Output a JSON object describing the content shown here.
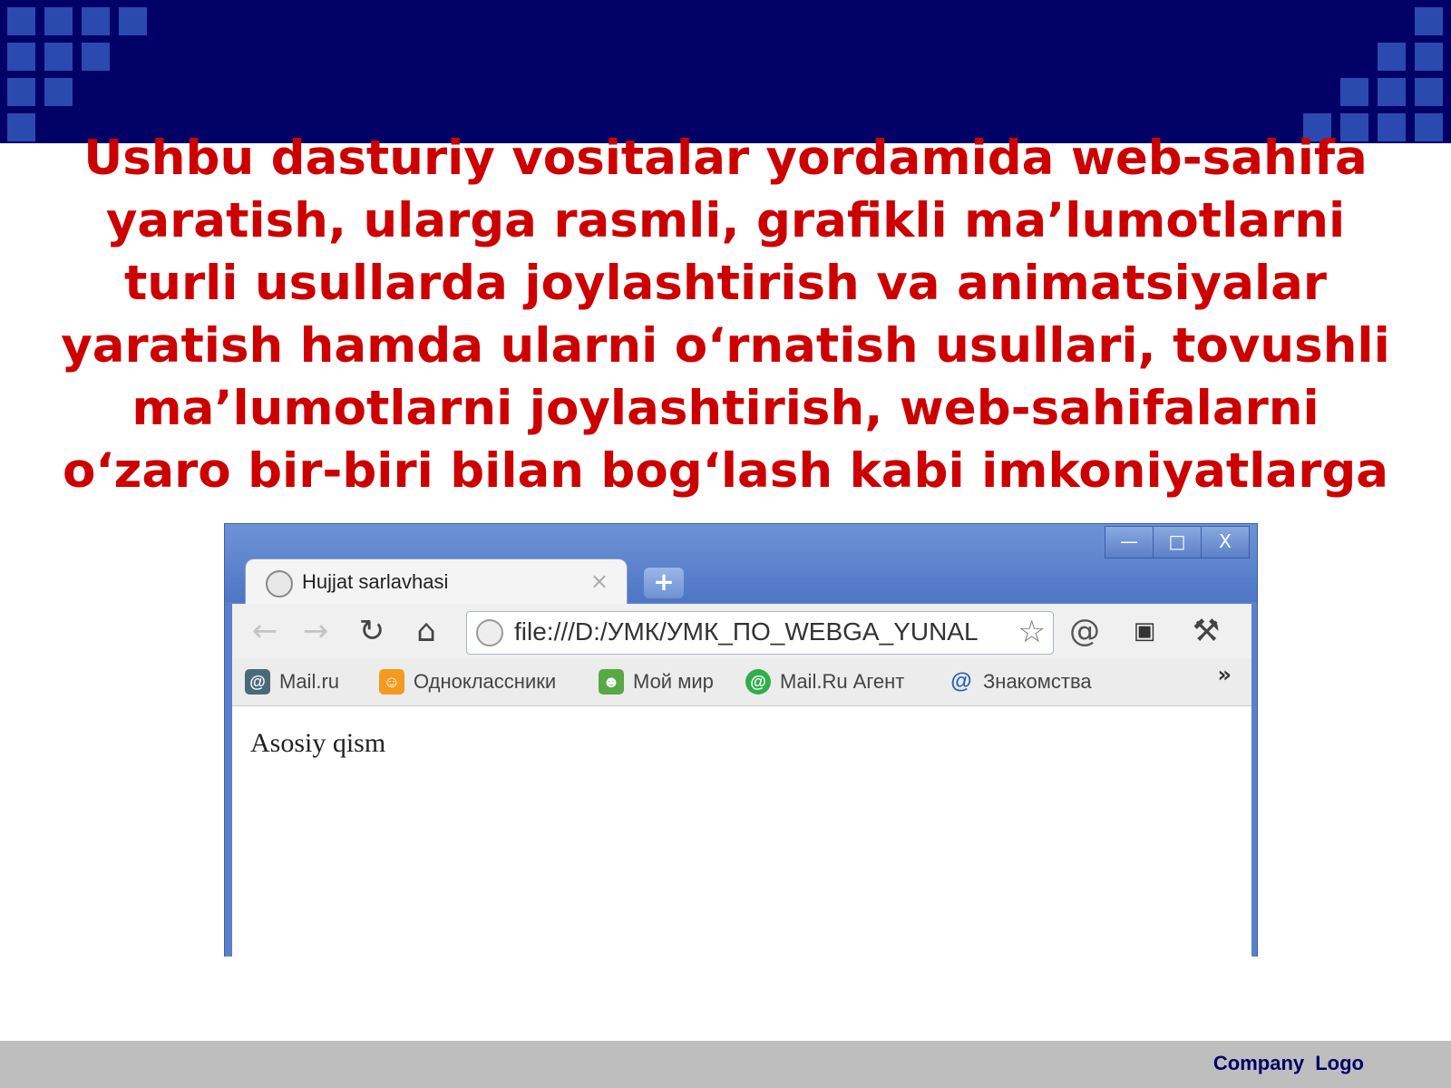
{
  "slide": {
    "title_lines": [
      "Ushbu dasturiy vositalar yordamida web-sahifa",
      "yaratish, ularga rasmli, grafikli ma’lumotlarni",
      "turli usullarda joylashtirish va animatsiyalar",
      "yaratish hamda ularni o‘rnatish usullari, tovushli",
      "ma’lumotlarni joylashtirish, web-sahifalarni",
      "o‘zaro bir-biri bilan bog‘lash kabi imkoniyatlarga"
    ],
    "footer_logo": "Company  Logo",
    "colors": {
      "header": "#000066",
      "title": "#cc0000",
      "footer": "#bebebe"
    }
  },
  "browser": {
    "window_buttons": {
      "minimize": "—",
      "maximize": "□",
      "close": "X"
    },
    "tab": {
      "title": "Hujjat sarlavhasi",
      "close": "×"
    },
    "new_tab": "+",
    "toolbar": {
      "back_icon": "arrow-left-icon",
      "forward_icon": "arrow-right-icon",
      "reload_icon": "reload-icon",
      "home_icon": "home-icon",
      "address": "file:///D:/УМК/УМК_ПО_WEBGA_YUNAL",
      "star_icon": "star-icon"
    },
    "bookmarks": [
      {
        "label": "Mail.ru",
        "icon": "mailru-icon"
      },
      {
        "label": "Одноклассники",
        "icon": "odnoklassniki-icon"
      },
      {
        "label": "Мой мир",
        "icon": "moi-mir-icon"
      },
      {
        "label": "Mail.Ru Агент",
        "icon": "mailru-agent-icon"
      },
      {
        "label": "Знакомства",
        "icon": "znakomstva-icon"
      }
    ],
    "bookmarks_more": "»",
    "content_text": "Asosiy qism"
  }
}
